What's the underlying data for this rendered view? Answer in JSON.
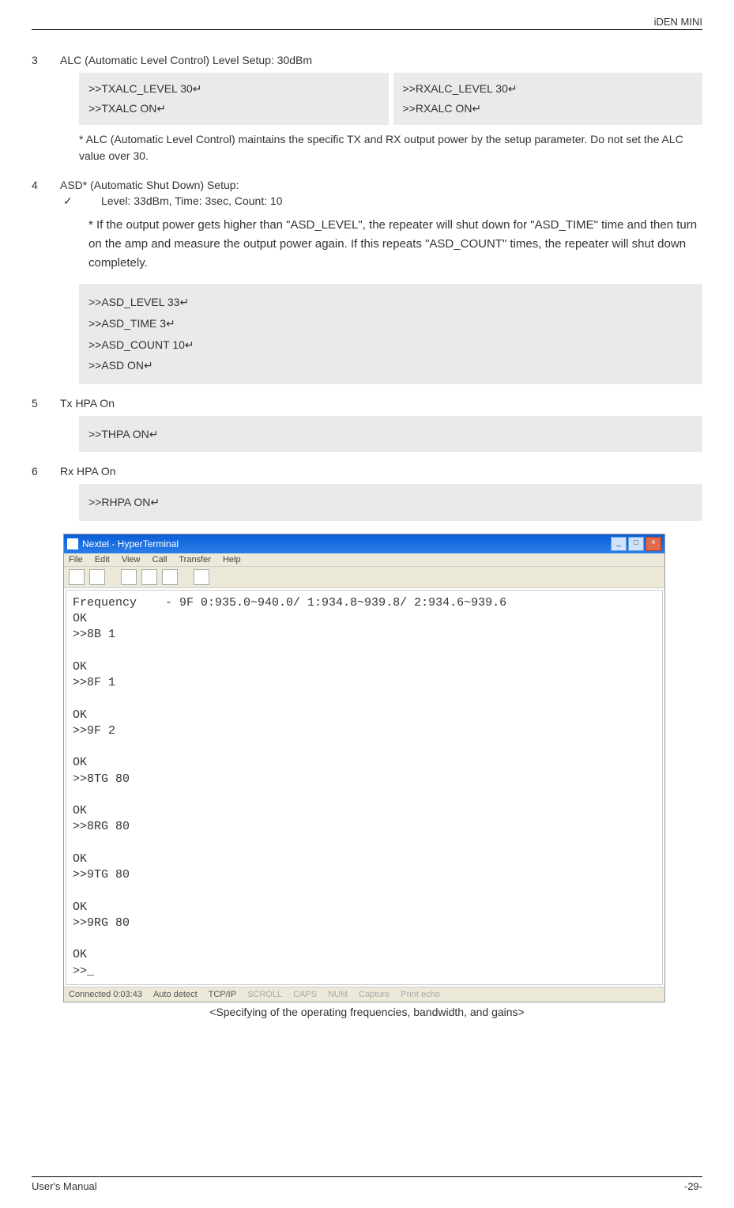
{
  "header": {
    "doc_title": "iDEN MINI"
  },
  "s3": {
    "num": "3",
    "title": "ALC (Automatic Level Control) Level Setup: 30dBm",
    "left": {
      "l1": ">>TXALC_LEVEL 30↵",
      "l2": ">>TXALC ON↵"
    },
    "right": {
      "l1": ">>RXALC_LEVEL 30↵",
      "l2": ">>RXALC ON↵"
    },
    "note": "* ALC (Automatic Level Control) maintains the specific TX and RX output power by the setup parameter. Do not set the ALC value over 30."
  },
  "s4": {
    "num": "4",
    "title": "ASD* (Automatic Shut Down) Setup:",
    "check": "✓",
    "level": "Level: 33dBm, Time: 3sec, Count: 10",
    "note": "* If the output power gets higher than \"ASD_LEVEL\", the repeater will shut down for \"ASD_TIME\" time and then turn on the amp and measure the output power again. If this repeats \"ASD_COUNT\" times, the repeater will shut down completely.",
    "code": {
      "l1": ">>ASD_LEVEL 33↵",
      "l2": ">>ASD_TIME 3↵",
      "l3": ">>ASD_COUNT 10↵",
      "l4": ">>ASD ON↵"
    }
  },
  "s5": {
    "num": "5",
    "title": "Tx HPA On",
    "code": ">>THPA ON↵"
  },
  "s6": {
    "num": "6",
    "title": "Rx HPA On",
    "code": ">>RHPA ON↵"
  },
  "ht": {
    "title": "Nextel - HyperTerminal",
    "menu": {
      "file": "File",
      "edit": "Edit",
      "view": "View",
      "call": "Call",
      "transfer": "Transfer",
      "help": "Help"
    },
    "terminal": "Frequency    - 9F 0:935.0~940.0/ 1:934.8~939.8/ 2:934.6~939.6\nOK\n>>8B 1\n\nOK\n>>8F 1\n\nOK\n>>9F 2\n\nOK\n>>8TG 80\n\nOK\n>>8RG 80\n\nOK\n>>9TG 80\n\nOK\n>>9RG 80\n\nOK\n>>_",
    "status": {
      "time": "Connected 0:03:43",
      "detect": "Auto detect",
      "proto": "TCP/IP",
      "s1": "SCROLL",
      "s2": "CAPS",
      "s3": "NUM",
      "s4": "Capture",
      "s5": "Print echo"
    }
  },
  "caption": "<Specifying of the operating frequencies, bandwidth, and gains>",
  "footer": {
    "left": "User's Manual",
    "right": "-29-"
  }
}
